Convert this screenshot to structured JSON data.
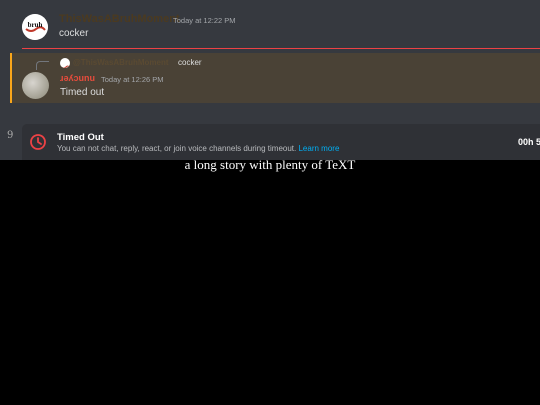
{
  "message1": {
    "username": "ThisWasABruhMoment",
    "timestamp": "Today at 12:22 PM",
    "text": "cocker",
    "avatar_text": "bruh"
  },
  "message2": {
    "reply_mention": "@ThisWasABruhMoment",
    "reply_text": "cocker",
    "username": "ɹǝʎɔunu",
    "timestamp": "Today at 12:26 PM",
    "text": "Timed out"
  },
  "timeout": {
    "title": "Timed Out",
    "description": "You can not chat, reply, react, or join voice channels during timeout.",
    "learn_more": "Learn more",
    "timer": "00h 5",
    "icon": "clock-icon"
  },
  "scribble": "9",
  "caption": "a long story with plenty of TeXT",
  "colors": {
    "background": "#36393f",
    "mention_highlight": "#4a4236",
    "accent_bar": "#faa61a",
    "divider": "#ed4245",
    "link": "#00aff4"
  }
}
